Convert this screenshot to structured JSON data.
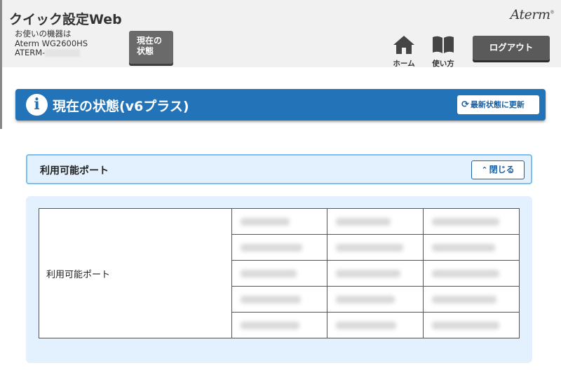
{
  "header": {
    "app_title": "クイック設定Web",
    "device_caption": "お使いの機器は",
    "device_model": "Aterm WG2600HS",
    "device_name_prefix": "ATERM-",
    "status_button_label_line1": "現在の",
    "status_button_label_line2": "状態",
    "brand": "Aterm",
    "brand_mark": "®",
    "nav": [
      {
        "label": "ホーム",
        "icon": "home-icon"
      },
      {
        "label": "使い方",
        "icon": "book-icon"
      }
    ],
    "logout_label": "ログアウト"
  },
  "banner": {
    "icon": "info-icon",
    "info_glyph": "i",
    "title": "現在の状態(v6プラス)",
    "refresh_glyph": "⟳",
    "refresh_label": "最新状態に更新",
    "color": "#2373b9"
  },
  "section": {
    "title": "利用可能ポート",
    "close_glyph": "⌃",
    "close_label": "閉じる"
  },
  "ports_table": {
    "row_header": "利用可能ポート",
    "cells_redacted": true
  },
  "colors": {
    "header_bg": "#f1f1f1",
    "panel_bg": "#e2f1fd",
    "panel_border": "#7cc0ef",
    "button_dark": "#5a5a5a"
  }
}
